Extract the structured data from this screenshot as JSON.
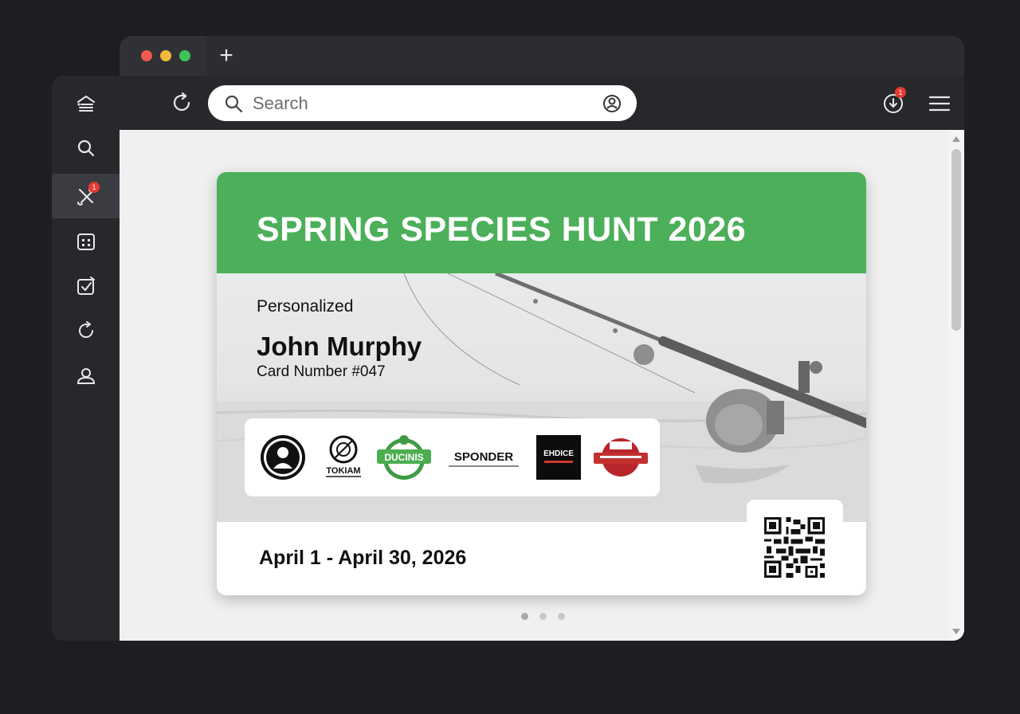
{
  "window": {
    "new_tab_label": "+"
  },
  "toolbar": {
    "search_placeholder": "Search",
    "downloads_badge": "1"
  },
  "sidebar": {
    "items": [
      {
        "name": "home",
        "icon": "home-list-icon"
      },
      {
        "name": "search",
        "icon": "search-icon"
      },
      {
        "name": "fishing-tools",
        "icon": "tools-icon",
        "active": true,
        "badge": "1"
      },
      {
        "name": "calendar",
        "icon": "calendar-icon"
      },
      {
        "name": "tasks",
        "icon": "checklist-icon"
      },
      {
        "name": "refresh",
        "icon": "refresh-icon"
      },
      {
        "name": "profile",
        "icon": "profile-icon"
      }
    ]
  },
  "card": {
    "title": "SPRING SPECIES HUNT 2026",
    "personalized_label": "Personalized",
    "holder_name": "John Murphy",
    "card_number": "Card Number #047",
    "date_range": "April 1 - April 30, 2026",
    "sponsors": [
      {
        "name": "sponsor-1"
      },
      {
        "name": "sponsor-2",
        "text": "TOKIAM"
      },
      {
        "name": "sponsor-3",
        "text": "DUCINIS"
      },
      {
        "name": "sponsor-4",
        "text": "SPONDER"
      },
      {
        "name": "sponsor-5",
        "text": "EHDICE"
      },
      {
        "name": "sponsor-6"
      }
    ]
  },
  "pager": {
    "total": 3,
    "active": 1
  },
  "colors": {
    "header_green": "#4caf5a",
    "badge_red": "#e53935",
    "chrome_dark": "#26282c"
  }
}
